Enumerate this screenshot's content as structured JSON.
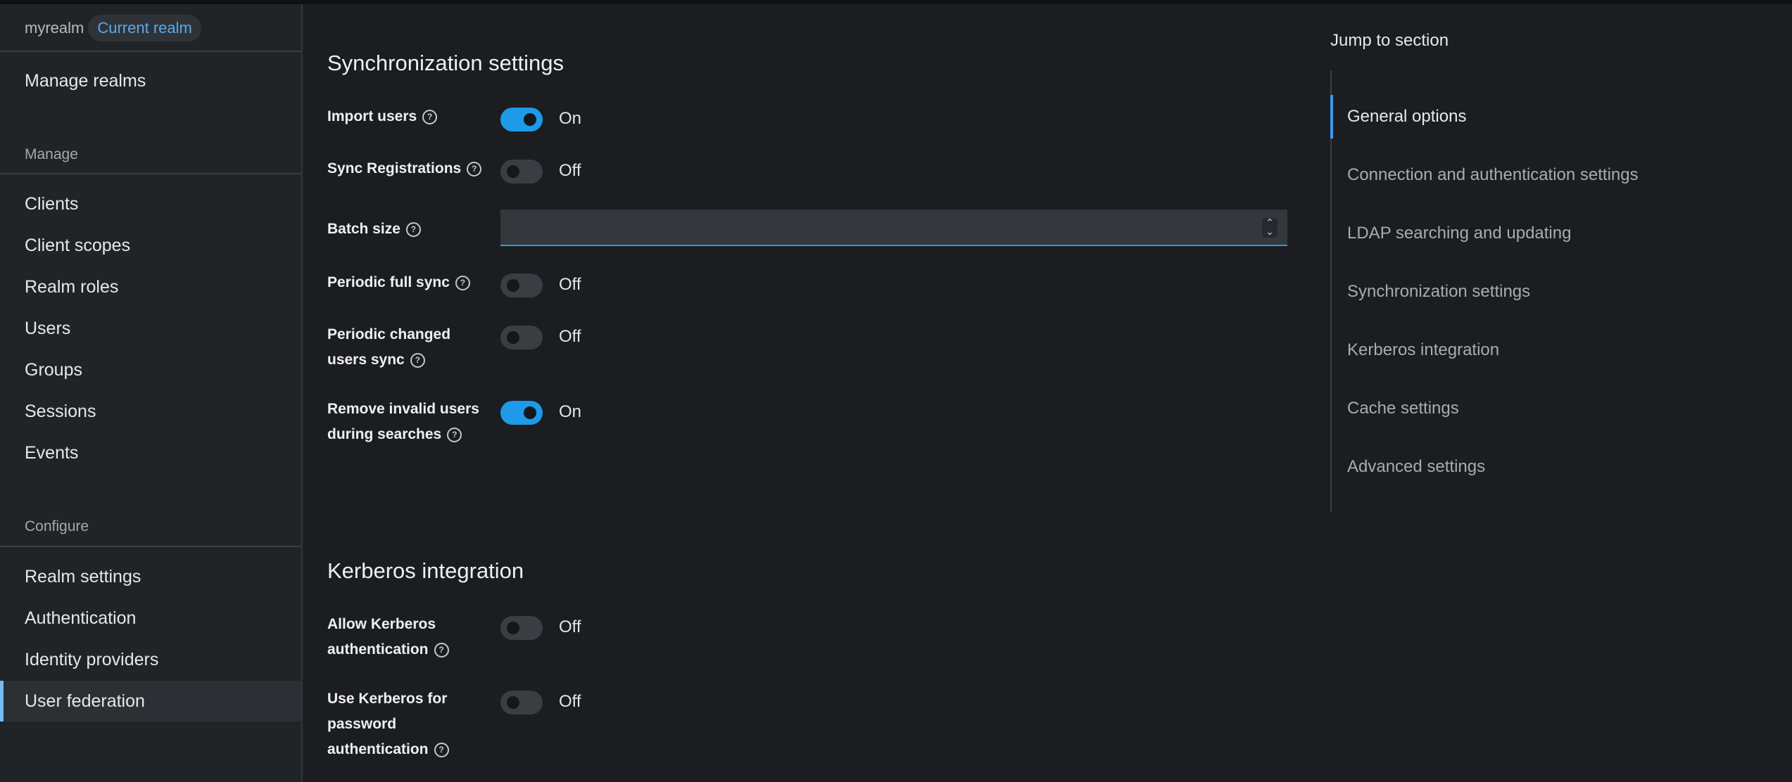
{
  "sidebar": {
    "realm_name": "myrealm",
    "realm_badge": "Current realm",
    "manage_realms": "Manage realms",
    "manage_title": "Manage",
    "manage_items": [
      "Clients",
      "Client scopes",
      "Realm roles",
      "Users",
      "Groups",
      "Sessions",
      "Events"
    ],
    "configure_title": "Configure",
    "configure_items": [
      "Realm settings",
      "Authentication",
      "Identity providers",
      "User federation"
    ],
    "active_item": "User federation"
  },
  "sync": {
    "title": "Synchronization settings",
    "import_users": {
      "label": "Import users",
      "state": "On"
    },
    "sync_registrations": {
      "label": "Sync Registrations",
      "state": "Off"
    },
    "batch_size": {
      "label": "Batch size",
      "value": ""
    },
    "periodic_full_sync": {
      "label": "Periodic full sync",
      "state": "Off"
    },
    "periodic_changed": {
      "label_line1": "Periodic changed",
      "label_line2": "users sync",
      "state": "Off"
    },
    "remove_invalid": {
      "label_line1": "Remove invalid users",
      "label_line2": "during searches",
      "state": "On"
    }
  },
  "kerberos": {
    "title": "Kerberos integration",
    "allow": {
      "label_line1": "Allow Kerberos",
      "label_line2": "authentication",
      "state": "Off"
    },
    "use_for_password": {
      "label_line1": "Use Kerberos for",
      "label_line2": "password",
      "label_line3": "authentication",
      "state": "Off"
    }
  },
  "jump": {
    "title": "Jump to section",
    "items": [
      "General options",
      "Connection and authentication settings",
      "LDAP searching and updating",
      "Synchronization settings",
      "Kerberos integration",
      "Cache settings",
      "Advanced settings"
    ],
    "active": "General options"
  },
  "icons": {
    "help": "help-circle-icon",
    "spinner": "number-spinner-icon"
  },
  "colors": {
    "accent": "#1e9ae8",
    "active_bar": "#73bcf7"
  }
}
